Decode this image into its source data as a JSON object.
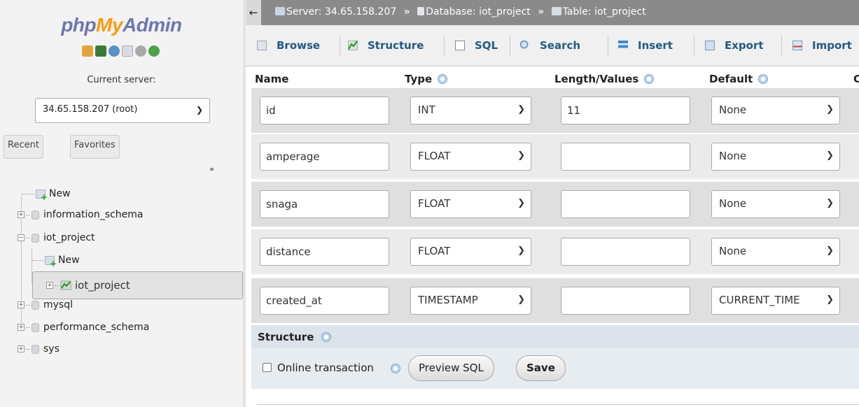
{
  "logo": {
    "part1": "php",
    "part2": "My",
    "part3": "Admin"
  },
  "nav": {
    "current_server_label": "Current server:",
    "server_value": "34.65.158.207 (root)",
    "recent_label": "Recent",
    "favorites_label": "Favorites",
    "tree": {
      "new": "New",
      "db1": "information_schema",
      "db2": "iot_project",
      "db2_new": "New",
      "db2_table": "iot_project",
      "db3": "mysql",
      "db4": "performance_schema",
      "db5": "sys"
    }
  },
  "breadcrumb": {
    "server": "Server: 34.65.158.207",
    "database": "Database: iot_project",
    "table": "Table: iot_project",
    "separator": "»"
  },
  "menu": {
    "browse": "Browse",
    "structure": "Structure",
    "sql": "SQL",
    "search": "Search",
    "insert": "Insert",
    "export": "Export",
    "import": "Import"
  },
  "columns": {
    "name": "Name",
    "type": "Type",
    "length": "Length/Values",
    "default": "Default",
    "extra": "C"
  },
  "rows": [
    {
      "name": "id",
      "type": "INT",
      "length": "11",
      "default": "None"
    },
    {
      "name": "amperage",
      "type": "FLOAT",
      "length": "",
      "default": "None"
    },
    {
      "name": "snaga",
      "type": "FLOAT",
      "length": "",
      "default": "None"
    },
    {
      "name": "distance",
      "type": "FLOAT",
      "length": "",
      "default": "None"
    },
    {
      "name": "created_at",
      "type": "TIMESTAMP",
      "length": "",
      "default": "CURRENT_TIME"
    }
  ],
  "structure_label": "Structure",
  "actions": {
    "online_transaction": "Online transaction",
    "preview_sql": "Preview SQL",
    "save": "Save"
  },
  "colors": {
    "accent": "#235a81",
    "topbar": "#8a8a8a",
    "logo_blue": "#6c78af",
    "logo_orange": "#f89c0e"
  }
}
